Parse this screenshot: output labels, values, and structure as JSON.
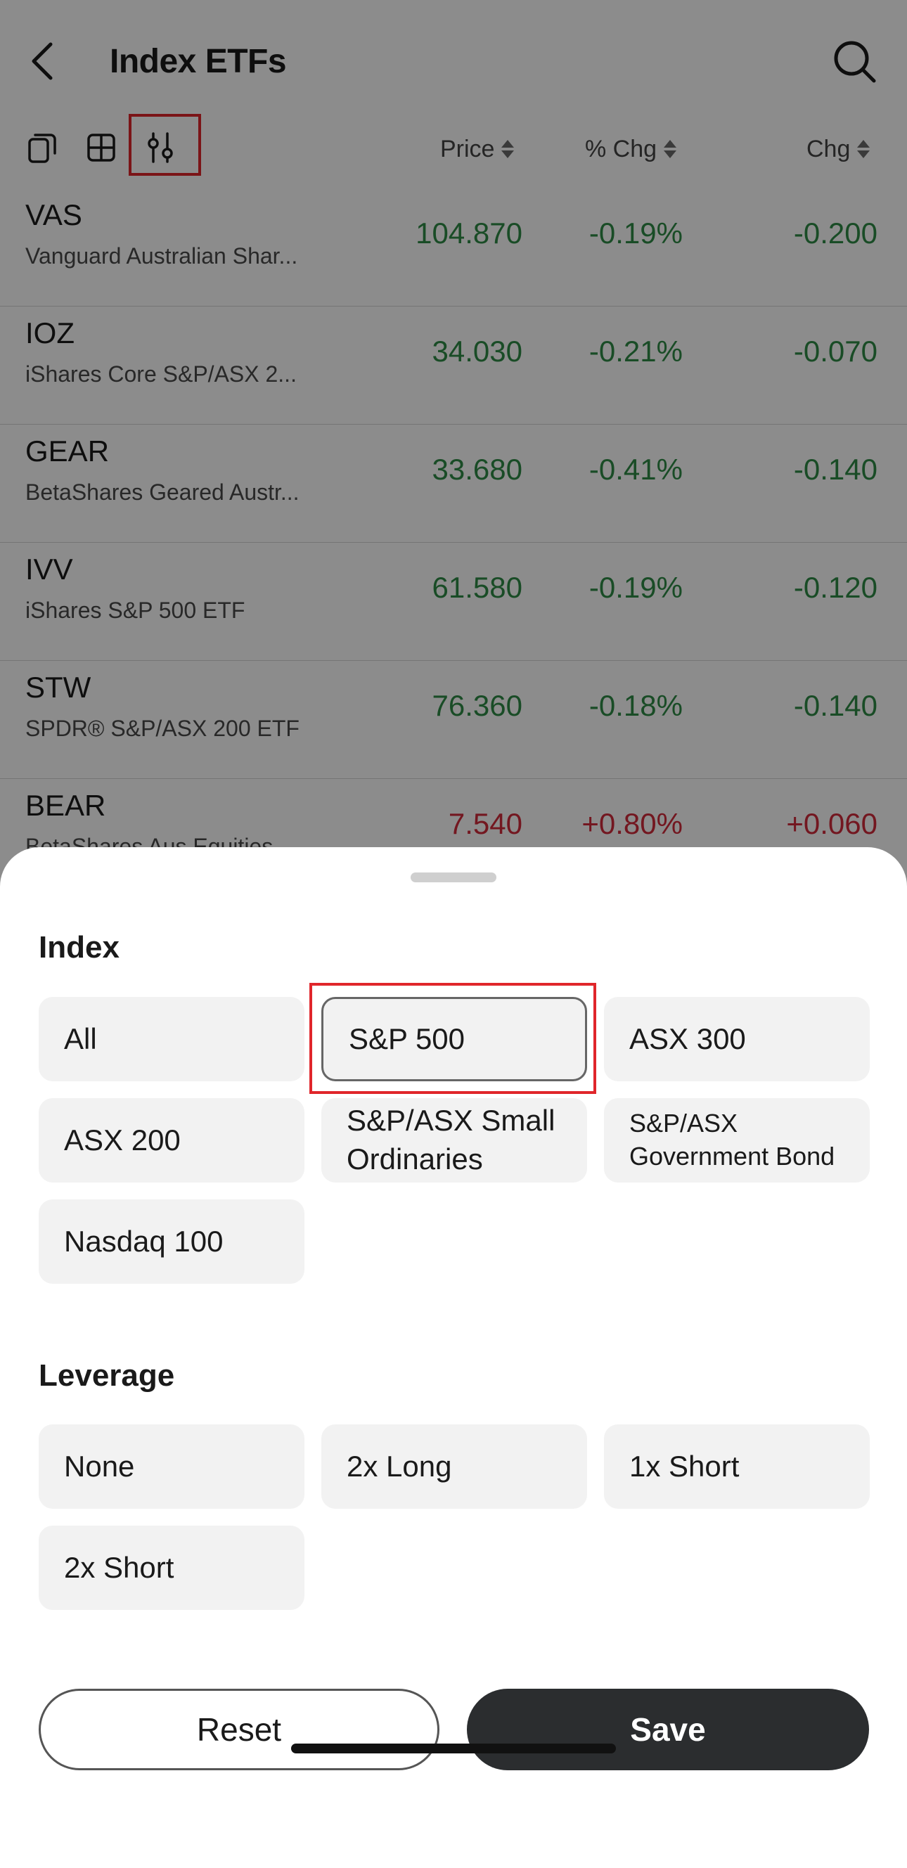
{
  "header": {
    "title": "Index ETFs"
  },
  "list_columns": {
    "price": "Price",
    "pct_chg": "% Chg",
    "chg": "Chg"
  },
  "rows": [
    {
      "symbol": "VAS",
      "name": "Vanguard Australian Shar...",
      "price": "104.870",
      "pct": "-0.19%",
      "chg": "-0.200"
    },
    {
      "symbol": "IOZ",
      "name": "iShares Core S&P/ASX 2...",
      "price": "34.030",
      "pct": "-0.21%",
      "chg": "-0.070"
    },
    {
      "symbol": "GEAR",
      "name": "BetaShares Geared Austr...",
      "price": "33.680",
      "pct": "-0.41%",
      "chg": "-0.140"
    },
    {
      "symbol": "IVV",
      "name": "iShares S&P 500 ETF",
      "price": "61.580",
      "pct": "-0.19%",
      "chg": "-0.120"
    },
    {
      "symbol": "STW",
      "name": "SPDR® S&P/ASX 200 ETF",
      "price": "76.360",
      "pct": "-0.18%",
      "chg": "-0.140"
    },
    {
      "symbol": "BEAR",
      "name": "BetaShares Aus Equities...",
      "price": "7.540",
      "pct": "+0.80%",
      "chg": "+0.060"
    }
  ],
  "colors": {
    "down": "#2f8a45",
    "up": "#d22b3b",
    "highlight": "#e0262b",
    "save_bg": "#2b2d2f"
  },
  "icons": [
    "back-arrow-icon",
    "search-icon",
    "copy-icon",
    "grid-icon",
    "filter-sliders-icon",
    "sort-arrows-icon"
  ],
  "sheet": {
    "index": {
      "title": "Index",
      "options": [
        "All",
        "S&P 500",
        "ASX 300",
        "ASX 200",
        "S&P/ASX Small Ordinaries",
        "S&P/ASX Government Bond",
        "Nasdaq 100"
      ],
      "selected": "S&P 500"
    },
    "leverage": {
      "title": "Leverage",
      "options": [
        "None",
        "2x Long",
        "1x Short",
        "2x Short"
      ]
    },
    "reset_label": "Reset",
    "save_label": "Save"
  }
}
